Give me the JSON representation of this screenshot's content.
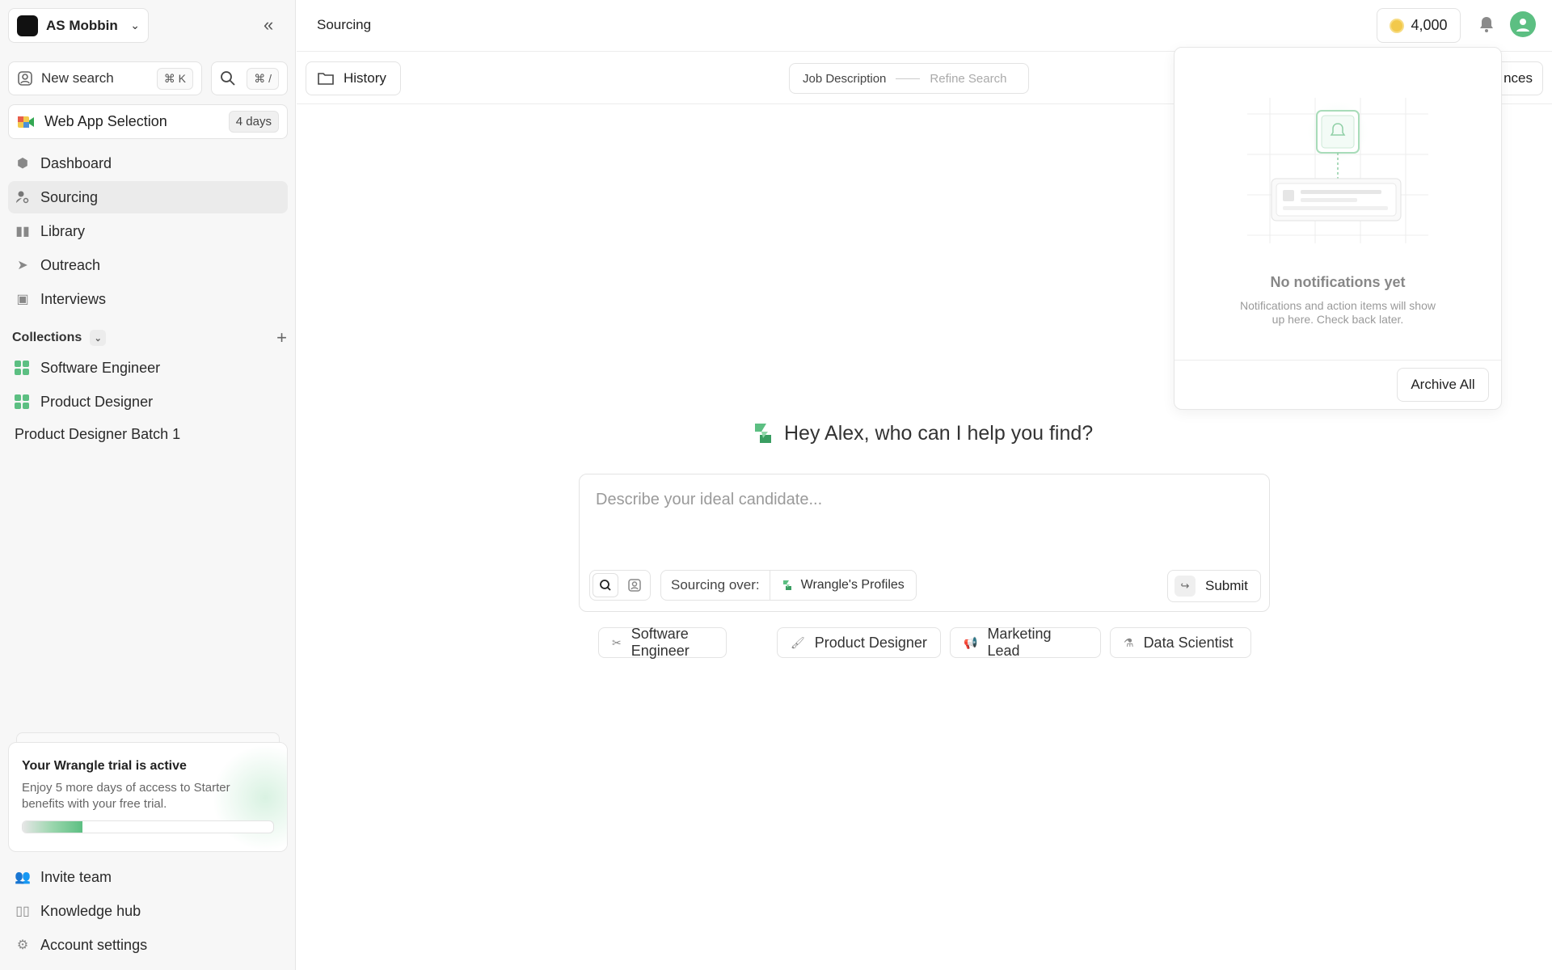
{
  "workspace": {
    "name": "AS Mobbin"
  },
  "sidebar": {
    "new_search": {
      "label": "New search",
      "shortcut": "⌘ K"
    },
    "search_shortcut": "⌘ /",
    "project": {
      "label": "Web App Selection",
      "badge": "4 days"
    },
    "nav": [
      {
        "label": "Dashboard",
        "icon": "home-icon"
      },
      {
        "label": "Sourcing",
        "icon": "person-search-icon",
        "active": true
      },
      {
        "label": "Library",
        "icon": "library-icon"
      },
      {
        "label": "Outreach",
        "icon": "send-icon"
      },
      {
        "label": "Interviews",
        "icon": "interview-icon"
      }
    ],
    "collections": {
      "title": "Collections",
      "items": [
        {
          "label": "Software Engineer",
          "icon": "collection-grid-icon"
        },
        {
          "label": "Product Designer",
          "icon": "collection-grid-icon"
        }
      ],
      "extra": "Product Designer Batch 1"
    },
    "trial": {
      "title": "Your Wrangle trial is active",
      "text": "Enjoy 5 more days of access to Starter benefits with your free trial.",
      "progress": 0.24
    },
    "bottom": [
      {
        "label": "Invite team",
        "icon": "team-icon"
      },
      {
        "label": "Knowledge hub",
        "icon": "book-icon"
      },
      {
        "label": "Account settings",
        "icon": "gear-icon"
      }
    ]
  },
  "header": {
    "title": "Sourcing",
    "credits": "4,000"
  },
  "subbar": {
    "history": "History",
    "steps": [
      "Job Description",
      "Refine Search"
    ],
    "preferences_partial": "nces"
  },
  "main": {
    "greeting": "Hey Alex, who can I help you find?",
    "placeholder": "Describe your ideal candidate...",
    "sourcing_label": "Sourcing over:",
    "sourcing_value": "Wrangle's Profiles",
    "submit": "Submit",
    "suggestions": [
      {
        "label": "Software Engineer",
        "icon": "tools-icon"
      },
      {
        "label": "Product Designer",
        "icon": "paint-roller-icon"
      },
      {
        "label": "Marketing Lead",
        "icon": "megaphone-icon"
      },
      {
        "label": "Data Scientist",
        "icon": "flask-icon"
      }
    ]
  },
  "notifications": {
    "title": "No notifications yet",
    "text": "Notifications and action items will show up here. Check back later.",
    "archive": "Archive All"
  },
  "colors": {
    "accent": "#5cbf82",
    "coin": "#f2c94c"
  }
}
